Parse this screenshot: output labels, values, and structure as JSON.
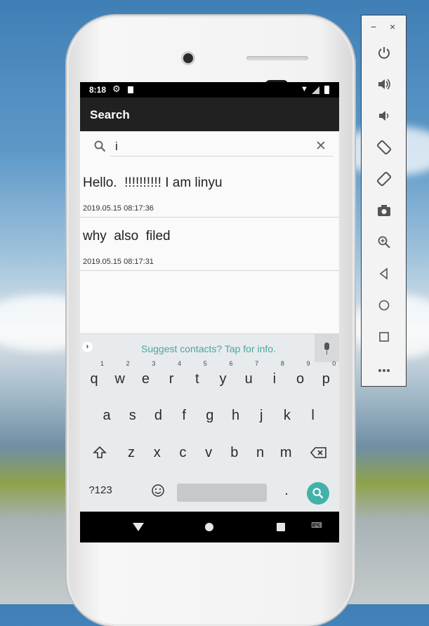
{
  "status_bar": {
    "time": "8:18",
    "settings_icon": "gear-icon",
    "sd_icon": "sd-card-icon",
    "wifi_icon": "wifi-icon",
    "signal_icon": "signal-icon",
    "battery_icon": "battery-icon"
  },
  "app_bar": {
    "title": "Search"
  },
  "search": {
    "value": "i",
    "search_icon": "search-icon",
    "clear_icon": "close-icon"
  },
  "results": [
    {
      "text": "Hello.  !!!!!!!!!! I am linyu",
      "date": "2019.05.15 08:17:36"
    },
    {
      "text": "why  also  filed",
      "date": "2019.05.15 08:17:31"
    }
  ],
  "keyboard": {
    "suggestion": "Suggest contacts? Tap for info.",
    "row1": [
      {
        "k": "q",
        "n": "1"
      },
      {
        "k": "w",
        "n": "2"
      },
      {
        "k": "e",
        "n": "3"
      },
      {
        "k": "r",
        "n": "4"
      },
      {
        "k": "t",
        "n": "5"
      },
      {
        "k": "y",
        "n": "6"
      },
      {
        "k": "u",
        "n": "7"
      },
      {
        "k": "i",
        "n": "8"
      },
      {
        "k": "o",
        "n": "9"
      },
      {
        "k": "p",
        "n": "0"
      }
    ],
    "row2": [
      "a",
      "s",
      "d",
      "f",
      "g",
      "h",
      "j",
      "k",
      "l"
    ],
    "row3": [
      "z",
      "x",
      "c",
      "v",
      "b",
      "n",
      "m"
    ],
    "symbols_key": "?123",
    "period_key": ".",
    "shift_icon": "shift-icon",
    "backspace_icon": "backspace-icon",
    "emoji_icon": "emoji-icon",
    "enter_icon": "search-icon",
    "mic_icon": "microphone-icon",
    "expand_icon": "chevron-right-icon"
  },
  "nav_bar": {
    "back_icon": "back-icon",
    "home_icon": "home-icon",
    "recents_icon": "recents-icon",
    "keyboard_icon": "keyboard-icon"
  },
  "emulator_panel": {
    "minimize": "−",
    "close": "×",
    "tools": [
      "power-icon",
      "volume-up-icon",
      "volume-down-icon",
      "rotate-left-icon",
      "rotate-right-icon",
      "camera-icon",
      "zoom-icon",
      "back-icon",
      "home-icon",
      "overview-icon",
      "more-icon"
    ]
  }
}
